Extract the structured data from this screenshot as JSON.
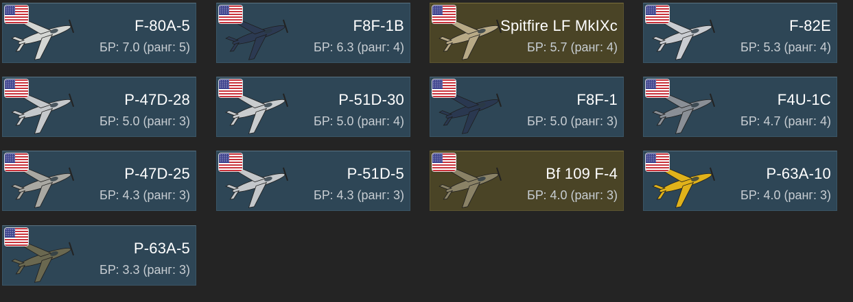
{
  "vehicles": [
    {
      "name": "F-80A-5",
      "br": "БР: 7.0 (ранг: 5)",
      "premium": false,
      "color": "#d4d6d3"
    },
    {
      "name": "F8F-1B",
      "br": "БР: 6.3 (ранг: 4)",
      "premium": false,
      "color": "#2c3a52"
    },
    {
      "name": "Spitfire LF MkIXc",
      "br": "БР: 5.7 (ранг: 4)",
      "premium": true,
      "color": "#b8aa86"
    },
    {
      "name": "F-82E",
      "br": "БР: 5.3 (ранг: 4)",
      "premium": false,
      "color": "#c9ccd1"
    },
    {
      "name": "P-47D-28",
      "br": "БР: 5.0 (ранг: 3)",
      "premium": false,
      "color": "#c5c8cb"
    },
    {
      "name": "P-51D-30",
      "br": "БР: 5.0 (ранг: 4)",
      "premium": false,
      "color": "#c9ccce"
    },
    {
      "name": "F8F-1",
      "br": "БР: 5.0 (ранг: 3)",
      "premium": false,
      "color": "#2a3850"
    },
    {
      "name": "F4U-1C",
      "br": "БР: 4.7 (ранг: 4)",
      "premium": false,
      "color": "#8a8f96"
    },
    {
      "name": "P-47D-25",
      "br": "БР: 4.3 (ранг: 3)",
      "premium": false,
      "color": "#a9a8a2"
    },
    {
      "name": "P-51D-5",
      "br": "БР: 4.3 (ранг: 3)",
      "premium": false,
      "color": "#c4c7ca"
    },
    {
      "name": "Bf 109 F-4",
      "br": "БР: 4.0 (ранг: 3)",
      "premium": true,
      "color": "#8a8266"
    },
    {
      "name": "P-63A-10",
      "br": "БР: 4.0 (ранг: 3)",
      "premium": false,
      "color": "#e0b21a"
    },
    {
      "name": "P-63A-5",
      "br": "БР: 3.3 (ранг: 3)",
      "premium": false,
      "color": "#6a6850"
    }
  ],
  "icons": {
    "flag": "usa-flag-icon",
    "plane": "aircraft-icon"
  },
  "colors": {
    "background": "#242424",
    "card": "#2e4656",
    "premium_card": "#4a4426",
    "text": "#ffffff",
    "subtext": "#c7cdd2"
  }
}
